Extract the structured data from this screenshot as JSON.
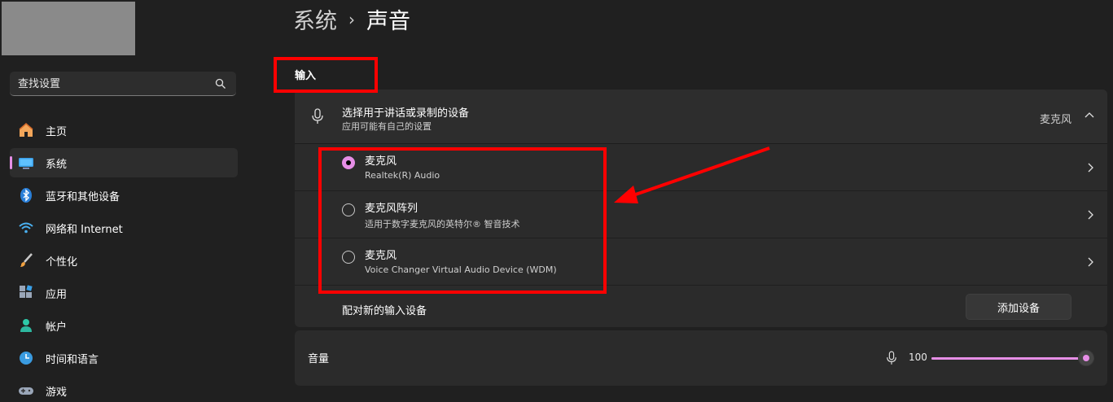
{
  "sidebar": {
    "search": {
      "placeholder": "查找设置"
    },
    "items": [
      {
        "label": "主页",
        "icon": "home-icon",
        "active": false
      },
      {
        "label": "系统",
        "icon": "system-icon",
        "active": true
      },
      {
        "label": "蓝牙和其他设备",
        "icon": "bluetooth-icon",
        "active": false
      },
      {
        "label": "网络和 Internet",
        "icon": "wifi-icon",
        "active": false
      },
      {
        "label": "个性化",
        "icon": "brush-icon",
        "active": false
      },
      {
        "label": "应用",
        "icon": "apps-icon",
        "active": false
      },
      {
        "label": "帐户",
        "icon": "account-icon",
        "active": false
      },
      {
        "label": "时间和语言",
        "icon": "time-language-icon",
        "active": false
      },
      {
        "label": "游戏",
        "icon": "gaming-icon",
        "active": false
      }
    ]
  },
  "header": {
    "parent": "系统",
    "separator": "›",
    "current": "声音"
  },
  "input_section": {
    "title": "输入",
    "header": {
      "title": "选择用于讲话或录制的设备",
      "subtitle": "应用可能有自己的设置",
      "selected": "麦克风"
    },
    "devices": [
      {
        "name": "麦克风",
        "description": "Realtek(R) Audio",
        "checked": true
      },
      {
        "name": "麦克风阵列",
        "description": "适用于数字麦克风的英特尔® 智音技术",
        "checked": false
      },
      {
        "name": "麦克风",
        "description": "Voice Changer Virtual Audio Device (WDM)",
        "checked": false
      }
    ],
    "pair": {
      "label": "配对新的输入设备",
      "button": "添加设备"
    }
  },
  "volume": {
    "label": "音量",
    "value": "100",
    "level_percent": 100
  },
  "colors": {
    "accent": "#e68ee6",
    "annotation": "#ff0000",
    "background": "#202020",
    "card": "#2b2b2b"
  }
}
